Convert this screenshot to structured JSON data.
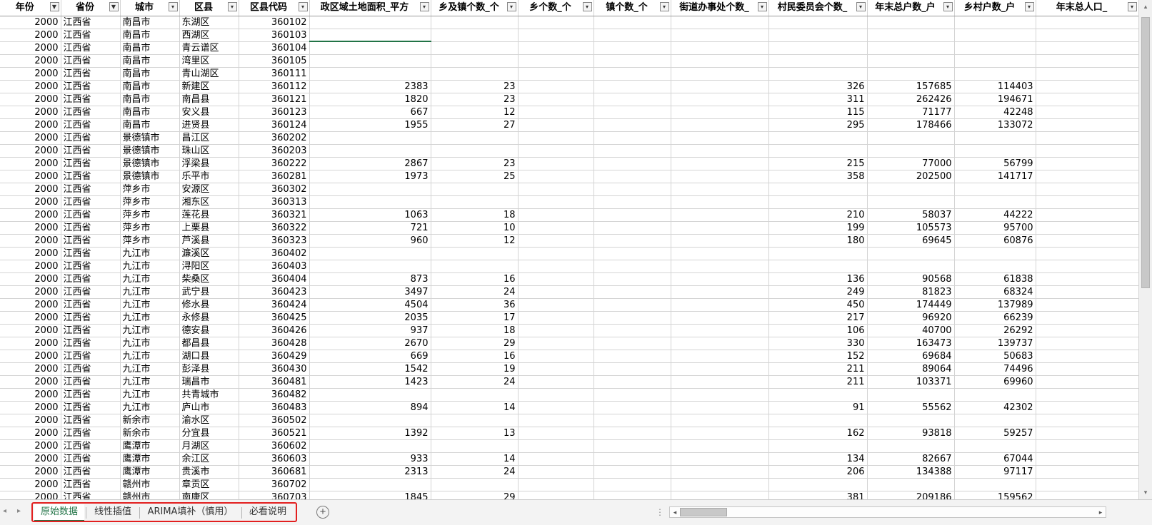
{
  "columns": [
    {
      "label": "年份",
      "filtered": true
    },
    {
      "label": "省份",
      "filtered": true
    },
    {
      "label": "城市",
      "filtered": false
    },
    {
      "label": "区县",
      "filtered": false
    },
    {
      "label": "区县代码",
      "filtered": false
    },
    {
      "label": "政区域土地面积_平方",
      "filtered": false
    },
    {
      "label": "乡及镇个数_个",
      "filtered": false
    },
    {
      "label": "乡个数_个",
      "filtered": false
    },
    {
      "label": "镇个数_个",
      "filtered": false
    },
    {
      "label": "街道办事处个数_",
      "filtered": false
    },
    {
      "label": "村民委员会个数_",
      "filtered": false
    },
    {
      "label": "年末总户数_户",
      "filtered": false
    },
    {
      "label": "乡村户数_户",
      "filtered": false
    },
    {
      "label": "年末总人口_",
      "filtered": false
    }
  ],
  "rows": [
    [
      "2000",
      "江西省",
      "南昌市",
      "东湖区",
      "360102",
      "",
      "",
      "",
      "",
      "",
      "",
      "",
      "",
      ""
    ],
    [
      "2000",
      "江西省",
      "南昌市",
      "西湖区",
      "360103",
      "",
      "",
      "",
      "",
      "",
      "",
      "",
      "",
      ""
    ],
    [
      "2000",
      "江西省",
      "南昌市",
      "青云谱区",
      "360104",
      "",
      "",
      "",
      "",
      "",
      "",
      "",
      "",
      ""
    ],
    [
      "2000",
      "江西省",
      "南昌市",
      "湾里区",
      "360105",
      "",
      "",
      "",
      "",
      "",
      "",
      "",
      "",
      ""
    ],
    [
      "2000",
      "江西省",
      "南昌市",
      "青山湖区",
      "360111",
      "",
      "",
      "",
      "",
      "",
      "",
      "",
      "",
      ""
    ],
    [
      "2000",
      "江西省",
      "南昌市",
      "新建区",
      "360112",
      "2383",
      "23",
      "",
      "",
      "",
      "326",
      "157685",
      "114403",
      ""
    ],
    [
      "2000",
      "江西省",
      "南昌市",
      "南昌县",
      "360121",
      "1820",
      "23",
      "",
      "",
      "",
      "311",
      "262426",
      "194671",
      ""
    ],
    [
      "2000",
      "江西省",
      "南昌市",
      "安义县",
      "360123",
      "667",
      "12",
      "",
      "",
      "",
      "115",
      "71177",
      "42248",
      ""
    ],
    [
      "2000",
      "江西省",
      "南昌市",
      "进贤县",
      "360124",
      "1955",
      "27",
      "",
      "",
      "",
      "295",
      "178466",
      "133072",
      ""
    ],
    [
      "2000",
      "江西省",
      "景德镇市",
      "昌江区",
      "360202",
      "",
      "",
      "",
      "",
      "",
      "",
      "",
      "",
      ""
    ],
    [
      "2000",
      "江西省",
      "景德镇市",
      "珠山区",
      "360203",
      "",
      "",
      "",
      "",
      "",
      "",
      "",
      "",
      ""
    ],
    [
      "2000",
      "江西省",
      "景德镇市",
      "浮梁县",
      "360222",
      "2867",
      "23",
      "",
      "",
      "",
      "215",
      "77000",
      "56799",
      ""
    ],
    [
      "2000",
      "江西省",
      "景德镇市",
      "乐平市",
      "360281",
      "1973",
      "25",
      "",
      "",
      "",
      "358",
      "202500",
      "141717",
      ""
    ],
    [
      "2000",
      "江西省",
      "萍乡市",
      "安源区",
      "360302",
      "",
      "",
      "",
      "",
      "",
      "",
      "",
      "",
      ""
    ],
    [
      "2000",
      "江西省",
      "萍乡市",
      "湘东区",
      "360313",
      "",
      "",
      "",
      "",
      "",
      "",
      "",
      "",
      ""
    ],
    [
      "2000",
      "江西省",
      "萍乡市",
      "莲花县",
      "360321",
      "1063",
      "18",
      "",
      "",
      "",
      "210",
      "58037",
      "44222",
      ""
    ],
    [
      "2000",
      "江西省",
      "萍乡市",
      "上栗县",
      "360322",
      "721",
      "10",
      "",
      "",
      "",
      "199",
      "105573",
      "95700",
      ""
    ],
    [
      "2000",
      "江西省",
      "萍乡市",
      "芦溪县",
      "360323",
      "960",
      "12",
      "",
      "",
      "",
      "180",
      "69645",
      "60876",
      ""
    ],
    [
      "2000",
      "江西省",
      "九江市",
      "濂溪区",
      "360402",
      "",
      "",
      "",
      "",
      "",
      "",
      "",
      "",
      ""
    ],
    [
      "2000",
      "江西省",
      "九江市",
      "浔阳区",
      "360403",
      "",
      "",
      "",
      "",
      "",
      "",
      "",
      "",
      ""
    ],
    [
      "2000",
      "江西省",
      "九江市",
      "柴桑区",
      "360404",
      "873",
      "16",
      "",
      "",
      "",
      "136",
      "90568",
      "61838",
      ""
    ],
    [
      "2000",
      "江西省",
      "九江市",
      "武宁县",
      "360423",
      "3497",
      "24",
      "",
      "",
      "",
      "249",
      "81823",
      "68324",
      ""
    ],
    [
      "2000",
      "江西省",
      "九江市",
      "修水县",
      "360424",
      "4504",
      "36",
      "",
      "",
      "",
      "450",
      "174449",
      "137989",
      ""
    ],
    [
      "2000",
      "江西省",
      "九江市",
      "永修县",
      "360425",
      "2035",
      "17",
      "",
      "",
      "",
      "217",
      "96920",
      "66239",
      ""
    ],
    [
      "2000",
      "江西省",
      "九江市",
      "德安县",
      "360426",
      "937",
      "18",
      "",
      "",
      "",
      "106",
      "40700",
      "26292",
      ""
    ],
    [
      "2000",
      "江西省",
      "九江市",
      "都昌县",
      "360428",
      "2670",
      "29",
      "",
      "",
      "",
      "330",
      "163473",
      "139737",
      ""
    ],
    [
      "2000",
      "江西省",
      "九江市",
      "湖口县",
      "360429",
      "669",
      "16",
      "",
      "",
      "",
      "152",
      "69684",
      "50683",
      ""
    ],
    [
      "2000",
      "江西省",
      "九江市",
      "彭泽县",
      "360430",
      "1542",
      "19",
      "",
      "",
      "",
      "211",
      "89064",
      "74496",
      ""
    ],
    [
      "2000",
      "江西省",
      "九江市",
      "瑞昌市",
      "360481",
      "1423",
      "24",
      "",
      "",
      "",
      "211",
      "103371",
      "69960",
      ""
    ],
    [
      "2000",
      "江西省",
      "九江市",
      "共青城市",
      "360482",
      "",
      "",
      "",
      "",
      "",
      "",
      "",
      "",
      ""
    ],
    [
      "2000",
      "江西省",
      "九江市",
      "庐山市",
      "360483",
      "894",
      "14",
      "",
      "",
      "",
      "91",
      "55562",
      "42302",
      ""
    ],
    [
      "2000",
      "江西省",
      "新余市",
      "渝水区",
      "360502",
      "",
      "",
      "",
      "",
      "",
      "",
      "",
      "",
      ""
    ],
    [
      "2000",
      "江西省",
      "新余市",
      "分宜县",
      "360521",
      "1392",
      "13",
      "",
      "",
      "",
      "162",
      "93818",
      "59257",
      ""
    ],
    [
      "2000",
      "江西省",
      "鹰潭市",
      "月湖区",
      "360602",
      "",
      "",
      "",
      "",
      "",
      "",
      "",
      "",
      ""
    ],
    [
      "2000",
      "江西省",
      "鹰潭市",
      "余江区",
      "360603",
      "933",
      "14",
      "",
      "",
      "",
      "134",
      "82667",
      "67044",
      ""
    ],
    [
      "2000",
      "江西省",
      "鹰潭市",
      "贵溪市",
      "360681",
      "2313",
      "24",
      "",
      "",
      "",
      "206",
      "134388",
      "97117",
      ""
    ],
    [
      "2000",
      "江西省",
      "赣州市",
      "章贡区",
      "360702",
      "",
      "",
      "",
      "",
      "",
      "",
      "",
      "",
      ""
    ],
    [
      "2000",
      "江西省",
      "赣州市",
      "南康区",
      "360703",
      "1845",
      "29",
      "",
      "",
      "",
      "381",
      "209186",
      "159562",
      ""
    ]
  ],
  "sheet_tabs": [
    {
      "label": "原始数据",
      "active": true
    },
    {
      "label": "线性插值",
      "active": false
    },
    {
      "label": "ARIMA填补（慎用）",
      "active": false
    },
    {
      "label": "必看说明",
      "active": false
    }
  ],
  "toolbar": {
    "add_sheet": "+",
    "nav_prev": "◂",
    "nav_next": "▸",
    "dots": "⋮",
    "scroll_left": "◂",
    "scroll_right": "▸",
    "scroll_up": "▴",
    "scroll_down": "▾"
  },
  "colors": {
    "active_tab": "#217346",
    "highlight_outline": "#e21f1f",
    "gridline": "#d4d4d4"
  },
  "icons": {
    "filter_applied": "filter-funnel-icon",
    "filter_dropdown": "dropdown-arrow-icon"
  }
}
